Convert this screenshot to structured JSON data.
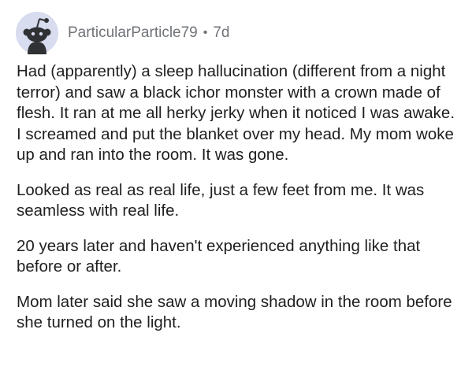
{
  "comment": {
    "author": "ParticularParticle79",
    "separator": "•",
    "age": "7d",
    "avatar_icon": "reddit-snoo-avatar-icon",
    "avatar_bg": "#d7dcef",
    "paragraphs": [
      "Had (apparently) a sleep hallucination (different from a night terror) and saw a black ichor monster with a crown made of flesh. It ran at me all herky jerky when it noticed I was awake. I screamed and put the blanket over my head. My mom woke up and ran into the room. It was gone.",
      "Looked as real as real life, just a few feet from me. It was seamless with real life.",
      "20 years later and haven't experienced anything like that before or after.",
      "Mom later said she saw a moving shadow in the room before she turned on the light."
    ]
  }
}
